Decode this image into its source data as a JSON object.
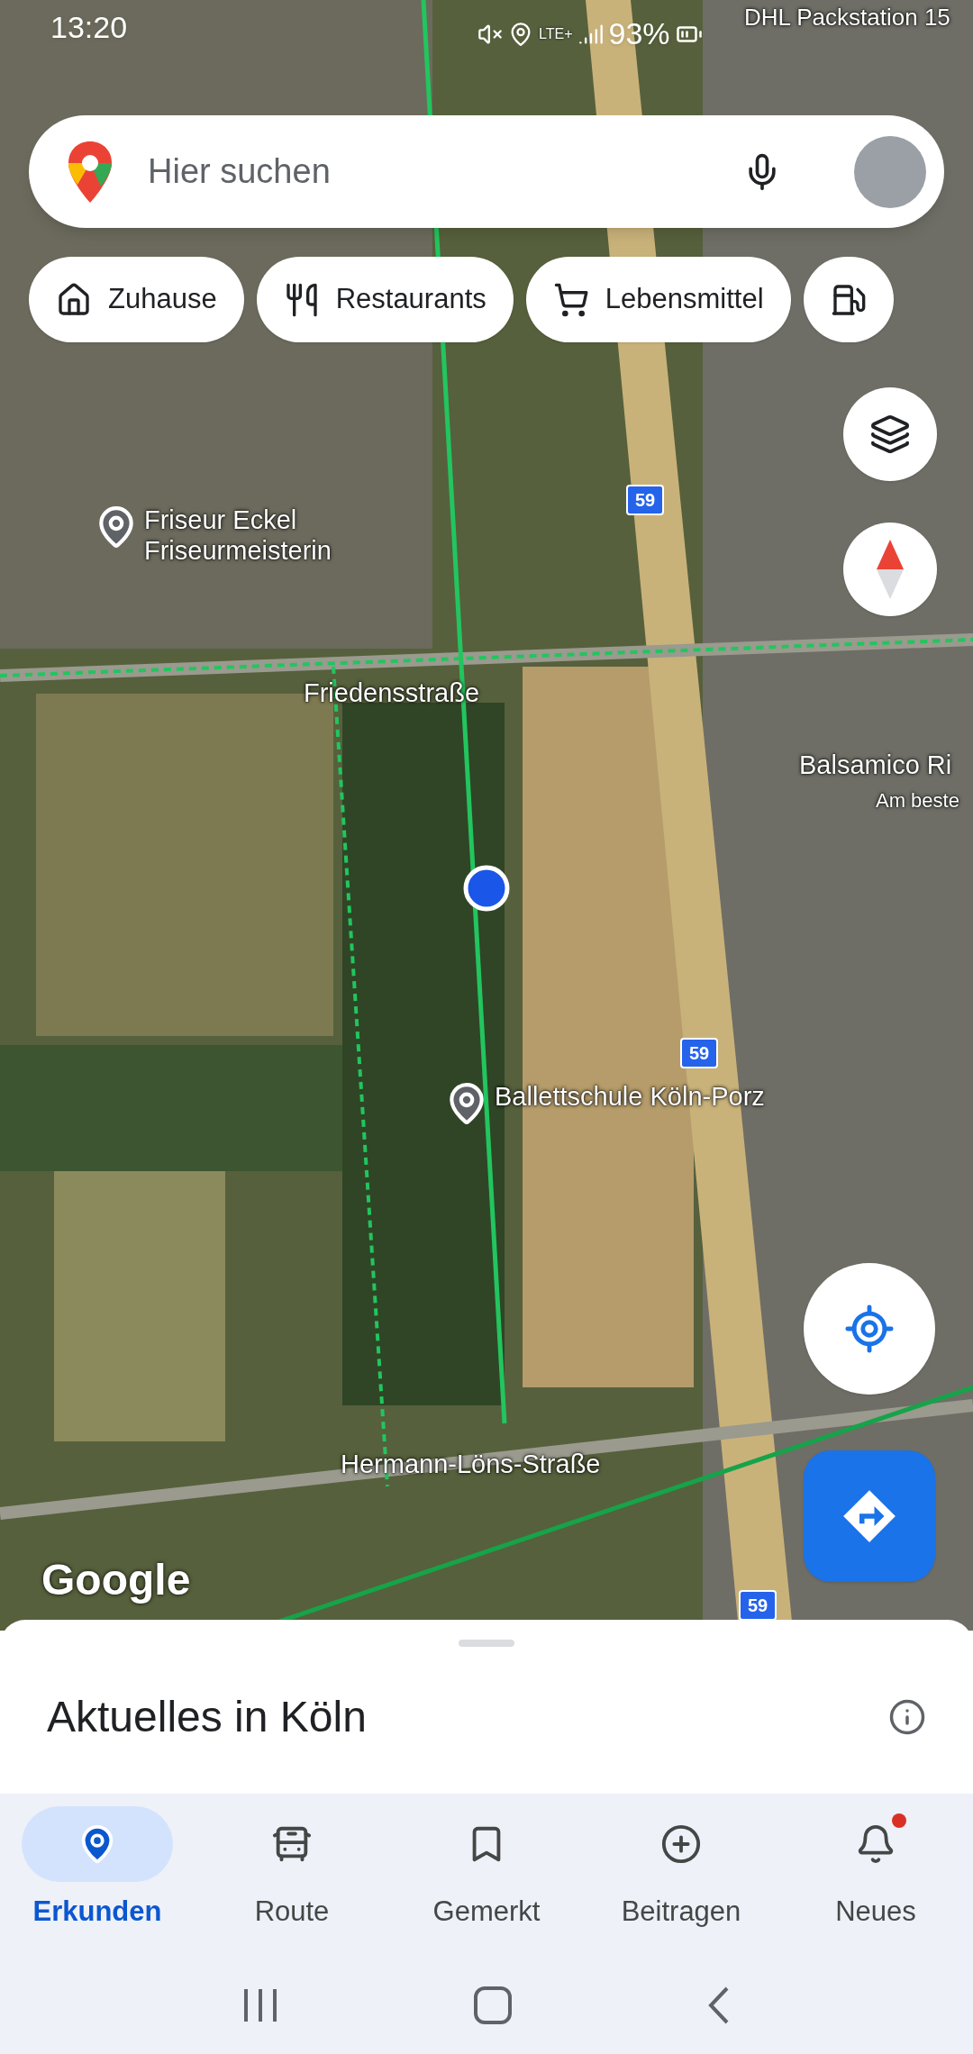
{
  "status_bar": {
    "time": "13:20",
    "network": "LTE+",
    "battery": "93%"
  },
  "search": {
    "placeholder": "Hier suchen"
  },
  "chips": [
    {
      "kind": "home",
      "label": "Zuhause"
    },
    {
      "kind": "restaurant",
      "label": "Restaurants"
    },
    {
      "kind": "grocery",
      "label": "Lebensmittel"
    },
    {
      "kind": "fuel"
    }
  ],
  "map_labels": [
    {
      "text": "DHL Packstation 15",
      "pin": false
    },
    {
      "text": "Friseur Eckel\nFriseurmeisterin",
      "pin": true
    },
    {
      "text": "Friedensstraße",
      "pin": false
    },
    {
      "text": "Balsamico Ri",
      "pin": false
    },
    {
      "text": "Am beste",
      "pin": false
    },
    {
      "text": "Ballettschule Köln-Porz",
      "pin": true
    },
    {
      "text": "Hermann-Löns-Straße",
      "pin": false
    }
  ],
  "road_shields": [
    "59",
    "59",
    "59"
  ],
  "map_brand": "Google",
  "sheet": {
    "title": "Aktuelles in Köln"
  },
  "nav": [
    {
      "kind": "explore",
      "label": "Erkunden",
      "selected": true,
      "badge": false
    },
    {
      "kind": "route",
      "label": "Route",
      "selected": false,
      "badge": false
    },
    {
      "kind": "saved",
      "label": "Gemerkt",
      "selected": false,
      "badge": false
    },
    {
      "kind": "contribute",
      "label": "Beitragen",
      "selected": false,
      "badge": false
    },
    {
      "kind": "updates",
      "label": "Neues",
      "selected": false,
      "badge": true
    }
  ]
}
